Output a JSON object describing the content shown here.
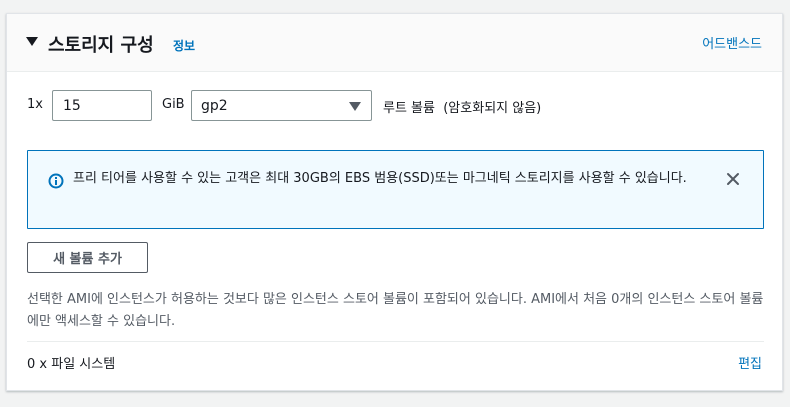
{
  "header": {
    "title": "스토리지 구성",
    "info_link": "정보",
    "advanced_link": "어드밴스드"
  },
  "volume_row": {
    "count_prefix": "1x",
    "size_value": "15",
    "size_unit": "GiB",
    "volume_type": "gp2",
    "description": "루트 볼륨  (암호화되지 않음)"
  },
  "alert": {
    "icon": "info-icon",
    "text": "프리 티어를 사용할 수 있는 고객은 최대 30GB의 EBS 범용(SSD)또는 마그네틱 스토리지를 사용할 수 있습니다.",
    "close_icon": "close-icon"
  },
  "add_volume_button": "새 볼륨 추가",
  "instance_store_note": "선택한 AMI에 인스턴스가 허용하는 것보다 많은 인스턴스 스토어 볼륨이 포함되어 있습니다. AMI에서 처음 0개의 인스턴스 스토어 볼륨에만 액세스할 수 있습니다.",
  "file_systems": {
    "label": "0 x 파일 시스템",
    "edit_link": "편집"
  },
  "colors": {
    "link": "#0073bb",
    "alert_border": "#0073bb",
    "alert_bg": "#f1faff",
    "text": "#16191f",
    "secondary_text": "#545b64"
  }
}
